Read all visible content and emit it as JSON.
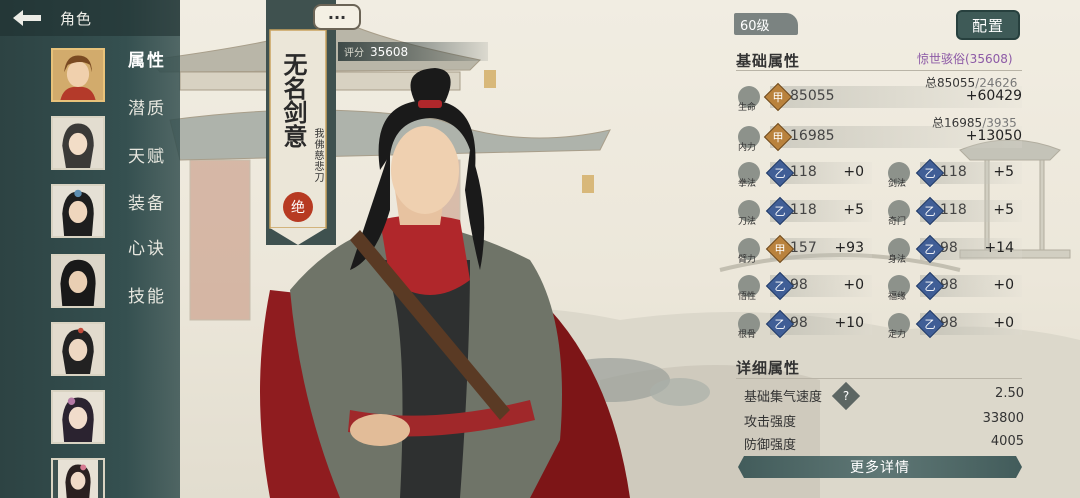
{
  "header": {
    "title": "角色",
    "back_icon": "back-arrow-icon"
  },
  "sidebar": {
    "menu": [
      {
        "label": "属性",
        "active": true
      },
      {
        "label": "潜质"
      },
      {
        "label": "天赋"
      },
      {
        "label": "装备"
      },
      {
        "label": "心诀"
      },
      {
        "label": "技能"
      }
    ]
  },
  "banner": {
    "title": "无名剑意",
    "subtitle": "我佛慈悲刀",
    "seal": "绝",
    "chat_icon": "···"
  },
  "score": {
    "label": "评分",
    "value": "35608"
  },
  "panel": {
    "level": "60级",
    "config_label": "配置",
    "basic_title": "基础属性",
    "fame": "惊世骇俗(35608)",
    "hp": {
      "label": "生命",
      "badge": "甲",
      "value": "85055",
      "total_prefix": "总85055",
      "total_max": "/24626",
      "bonus": "+60429"
    },
    "mp": {
      "label": "内力",
      "badge": "甲",
      "value": "16985",
      "total_prefix": "总16985",
      "total_max": "/3935",
      "bonus": "+13050"
    },
    "stats": [
      {
        "label": "拳法",
        "badge": "乙",
        "value": "118",
        "bonus": "+0"
      },
      {
        "label": "剑法",
        "badge": "乙",
        "value": "118",
        "bonus": "+5"
      },
      {
        "label": "刀法",
        "badge": "乙",
        "value": "118",
        "bonus": "+5"
      },
      {
        "label": "奇门",
        "badge": "乙",
        "value": "118",
        "bonus": "+5"
      },
      {
        "label": "臂力",
        "badge": "甲",
        "value": "157",
        "bonus": "+93"
      },
      {
        "label": "身法",
        "badge": "乙",
        "value": "98",
        "bonus": "+14"
      },
      {
        "label": "悟性",
        "badge": "乙",
        "value": "98",
        "bonus": "+0"
      },
      {
        "label": "福缘",
        "badge": "乙",
        "value": "98",
        "bonus": "+0"
      },
      {
        "label": "根骨",
        "badge": "乙",
        "value": "98",
        "bonus": "+10"
      },
      {
        "label": "定力",
        "badge": "乙",
        "value": "98",
        "bonus": "+0"
      }
    ],
    "detail_title": "详细属性",
    "details": [
      {
        "label": "基础集气速度",
        "value": "2.50",
        "help": "?"
      },
      {
        "label": "攻击强度",
        "value": "33800"
      },
      {
        "label": "防御强度",
        "value": "4005"
      }
    ],
    "more_label": "更多详情"
  },
  "colors": {
    "sidebar": "#355050",
    "accent_gold": "#b9823d",
    "accent_blue": "#405e96",
    "fame": "#8d5aa6"
  }
}
